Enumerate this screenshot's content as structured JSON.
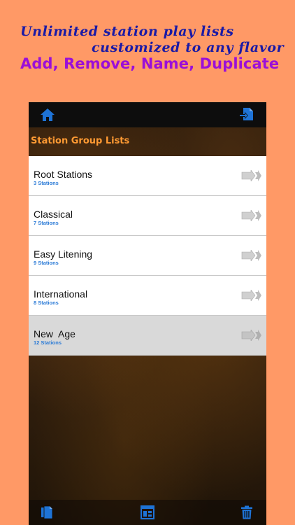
{
  "promo": {
    "line1": "Unlimited station play lists",
    "line2": "customized to any flavor",
    "line3": "Add, Remove, Name, Duplicate",
    "colors": {
      "line1": "#1a1aa6",
      "line3": "#9b0fd8",
      "background": "#ff9966"
    }
  },
  "navbar": {
    "left_icon": "home-icon",
    "right_icon": "import-icon"
  },
  "section": {
    "title": "Station Group Lists",
    "color": "#ff9a33"
  },
  "stations": [
    {
      "name": "Root Stations",
      "count": "3 Stations",
      "selected": false
    },
    {
      "name": "Classical",
      "count": "7 Stations",
      "selected": false
    },
    {
      "name": "Easy Litening",
      "count": "9 Stations",
      "selected": false
    },
    {
      "name": "International",
      "count": "8 Stations",
      "selected": false
    },
    {
      "name": "New  Age",
      "count": "12 Stations",
      "selected": true
    }
  ],
  "toolbar": {
    "left_icon": "copy-icon",
    "center_icon": "layout-icon",
    "right_icon": "trash-icon",
    "icon_color": "#1e73d6"
  }
}
